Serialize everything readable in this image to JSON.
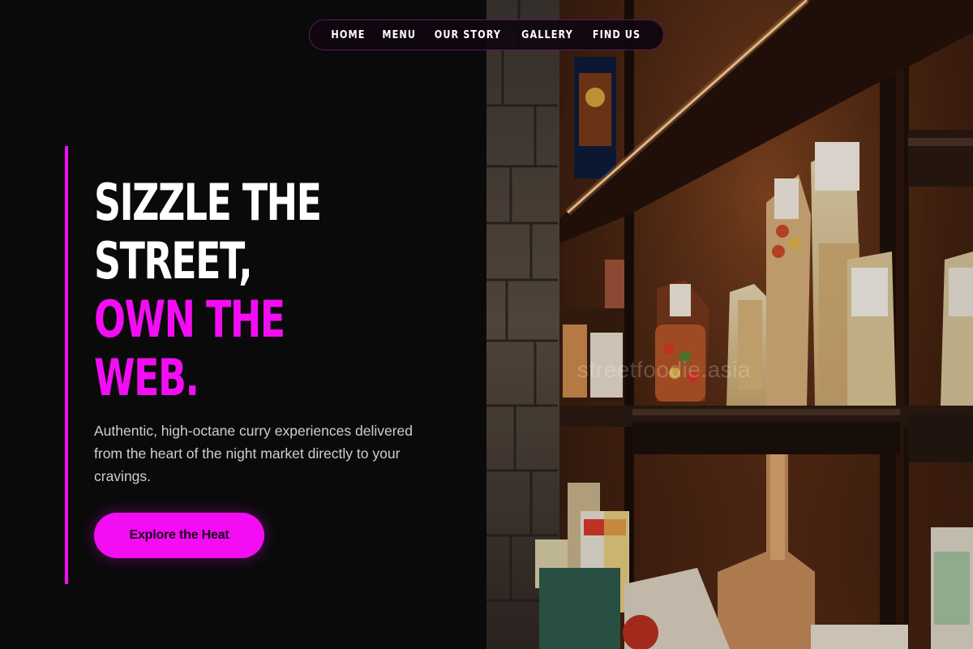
{
  "nav": {
    "items": [
      {
        "label": "HOME"
      },
      {
        "label": "MENU"
      },
      {
        "label": "OUR STORY"
      },
      {
        "label": "GALLERY"
      },
      {
        "label": "FIND US"
      }
    ]
  },
  "hero": {
    "headline_white_1": "SIZZLE THE",
    "headline_white_2": "STREET,",
    "headline_accent_1": "OWN THE",
    "headline_accent_2": "WEB.",
    "subtext": "Authentic, high-octane curry experiences delivered from the heart of the night market directly to your cravings.",
    "cta_label": "Explore the Heat"
  },
  "image": {
    "watermark": "streetfoodie.asia"
  },
  "colors": {
    "accent": "#f20df2",
    "background": "#0a0a0b",
    "text": "#ffffff",
    "subtext": "#d0cdd3"
  }
}
